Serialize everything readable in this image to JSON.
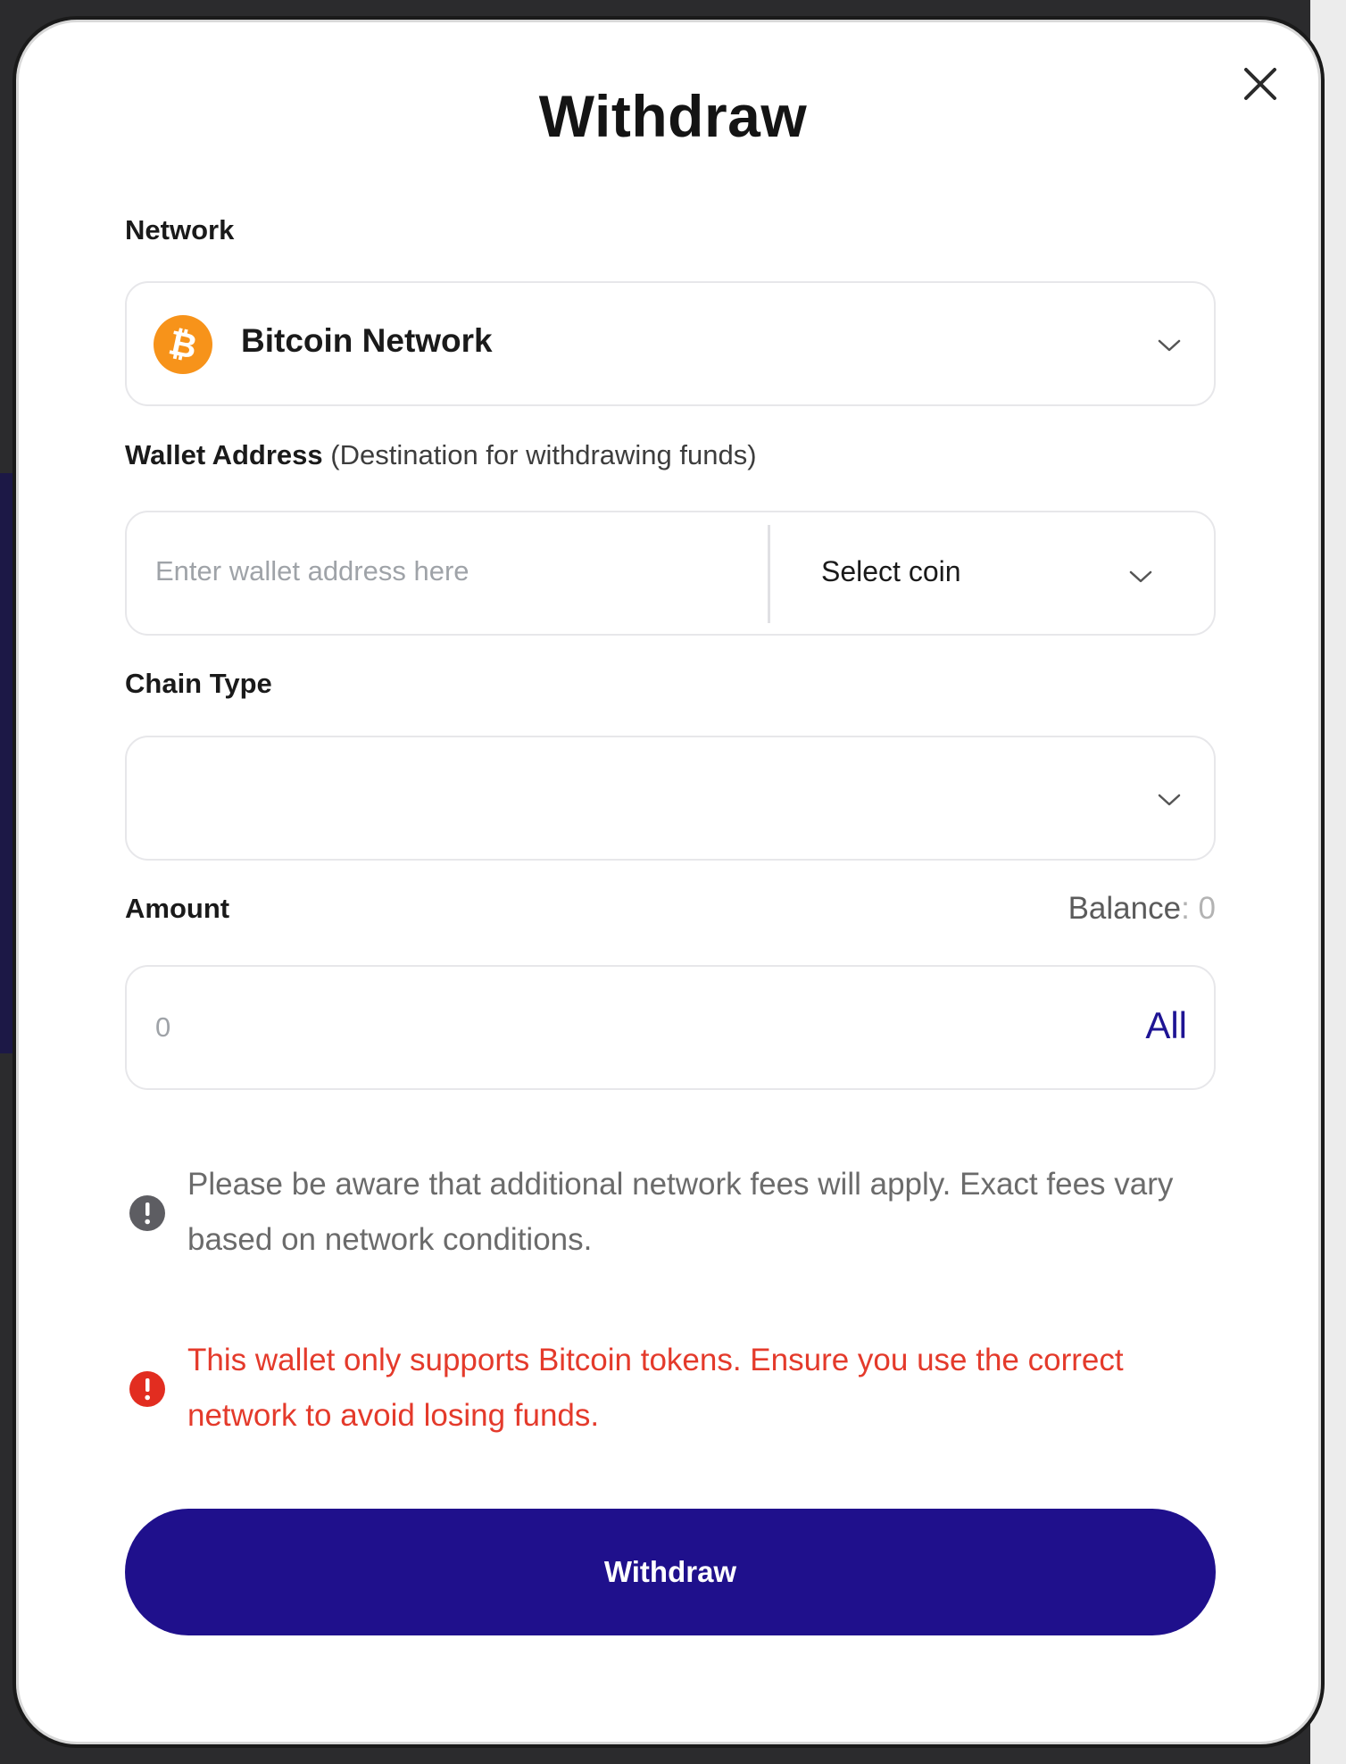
{
  "modal": {
    "title": "Withdraw"
  },
  "network": {
    "label": "Network",
    "selected": "Bitcoin Network",
    "icon": "bitcoin-icon",
    "icon_color": "#f7931a"
  },
  "wallet_address": {
    "label": "Wallet Address",
    "hint": "(Destination for withdrawing funds)",
    "placeholder": "Enter wallet address here",
    "coin_select": "Select coin"
  },
  "chain_type": {
    "label": "Chain Type",
    "selected": ""
  },
  "amount": {
    "label": "Amount",
    "balance_label": "Balance",
    "balance_sep": ":",
    "balance_value": "0",
    "placeholder": "0",
    "all_label": "All"
  },
  "notices": {
    "fees": "Please be aware that additional network fees will apply. Exact fees vary based on network conditions.",
    "warning": "This wallet only supports Bitcoin tokens. Ensure you use the correct network to avoid losing funds."
  },
  "actions": {
    "withdraw_label": "Withdraw"
  },
  "colors": {
    "primary": "#1f108c",
    "error": "#e43a2b",
    "muted_text": "#6b6b6b"
  }
}
